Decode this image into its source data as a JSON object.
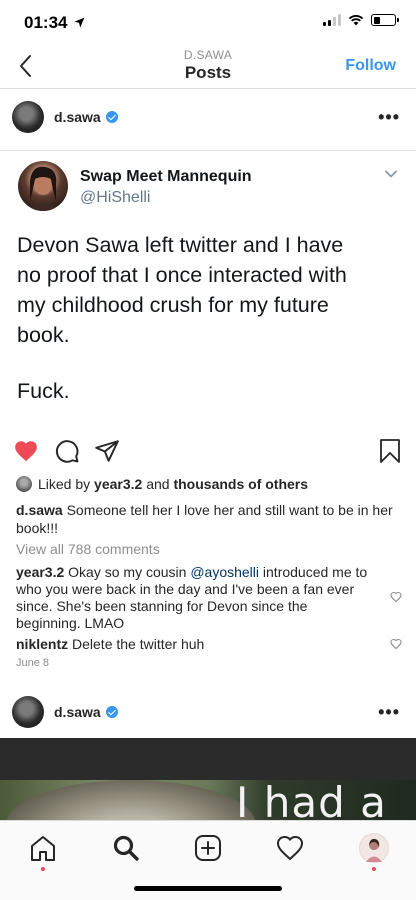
{
  "status_bar": {
    "time": "01:34",
    "signal_bars_filled": 2,
    "signal_bars_total": 4,
    "battery_level": 0.3
  },
  "header": {
    "subtitle": "D.SAWA",
    "title": "Posts",
    "follow_label": "Follow"
  },
  "post1": {
    "username": "d.sawa",
    "verified": true,
    "more_label": "•••",
    "tweet": {
      "name": "Swap Meet Mannequin",
      "handle": "@HiShelli",
      "text_lines": [
        "Devon Sawa left twitter and I have",
        "no proof that I once interacted with",
        "my childhood crush for my future",
        "book."
      ],
      "text_extra": "Fuck."
    },
    "liked": true,
    "likes": {
      "prefix": "Liked by",
      "user": "year3.2",
      "joiner": "and",
      "others": "thousands of others"
    },
    "caption": {
      "user": "d.sawa",
      "text": "Someone tell her I love her and still want to be in her book!!!"
    },
    "view_all_comments": "View all 788 comments",
    "comments": [
      {
        "user": "year3.2",
        "text_before": "Okay so my cousin",
        "mention": "@ayoshelli",
        "text_after": "introduced me to who you were back in the day and I've been a fan ever since.  She's been stanning for Devon since the beginning. LMAO"
      },
      {
        "user": "niklentz",
        "text": "Delete the twitter huh"
      }
    ],
    "date": "June 8"
  },
  "post2": {
    "username": "d.sawa",
    "verified": true,
    "more_label": "•••",
    "image_text": "I had a"
  },
  "tabbar": {
    "items": [
      "home-icon",
      "search-icon",
      "new-post-icon",
      "activity-heart-icon",
      "profile-avatar"
    ],
    "dots": [
      "home",
      "profile"
    ]
  },
  "colors": {
    "accent": "#3897f0",
    "like_red": "#ed4956",
    "text": "#262626",
    "muted": "#8e8e8e"
  }
}
